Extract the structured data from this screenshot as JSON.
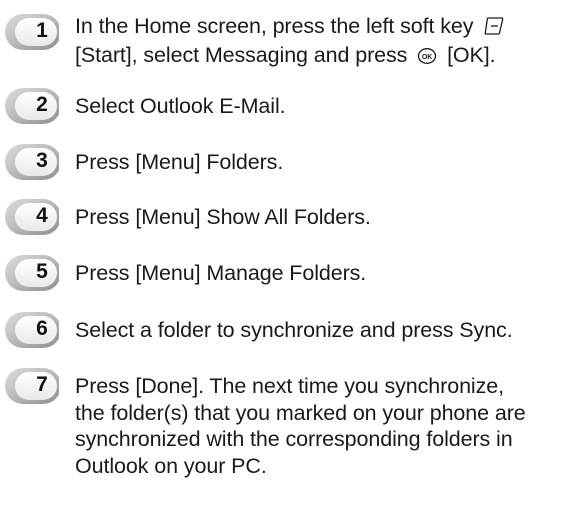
{
  "steps": [
    {
      "number": "1",
      "line1_a": "In the Home screen, press the left soft key",
      "line2_a": "[Start], select Messaging and press",
      "line2_b": "[OK].",
      "icons": [
        "soft-key-icon",
        "ok-key-icon"
      ]
    },
    {
      "number": "2",
      "text": "Select Outlook E-Mail."
    },
    {
      "number": "3",
      "text": "Press [Menu] Folders."
    },
    {
      "number": "4",
      "text": "Press [Menu] Show All Folders."
    },
    {
      "number": "5",
      "text": "Press [Menu] Manage Folders."
    },
    {
      "number": "6",
      "text": "Select a folder to synchronize and press Sync."
    },
    {
      "number": "7",
      "lines": [
        "Press [Done]. The next time you synchronize,",
        "the folder(s) that you marked on your phone are",
        "synchronized with the corresponding folders in",
        "Outlook on your PC."
      ]
    }
  ],
  "colors": {
    "badge_light": "#ececec",
    "badge_dark": "#8a8a8a",
    "text": "#1a1a1a"
  }
}
